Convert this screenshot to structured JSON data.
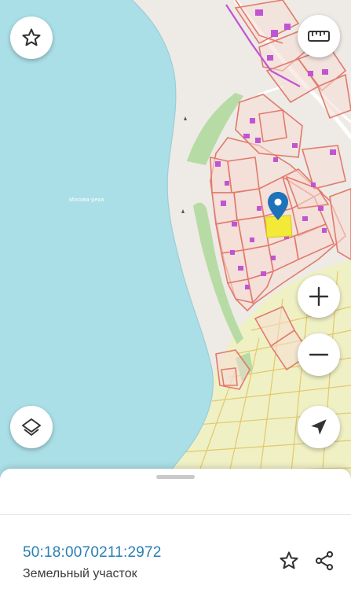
{
  "map": {
    "water_label": "Москва-река",
    "colors": {
      "water": "#abdfe7",
      "land": "#eeeae6",
      "forest": "#b7dba4",
      "parcel_border": "#e27a6c",
      "parcel_fill": "#f6dcd6",
      "building": "#c154d2",
      "road": "#ffffff",
      "zone": "#f0f0c5",
      "zone_lines": "#e2c86a",
      "selected_parcel": "#f2ea37",
      "marker": "#1e72b8"
    }
  },
  "controls": {
    "favorite": {
      "icon": "star-icon"
    },
    "ruler": {
      "icon": "ruler-icon"
    },
    "zoom_in": {
      "icon": "plus-icon"
    },
    "zoom_out": {
      "icon": "minus-icon"
    },
    "layers": {
      "icon": "layers-icon"
    },
    "locate": {
      "icon": "navigation-arrow-icon"
    }
  },
  "sheet": {
    "cadastral_number": "50:18:0070211:2972",
    "object_type": "Земельный участок",
    "actions": [
      {
        "icon": "star-outline-icon"
      },
      {
        "icon": "share-icon"
      }
    ]
  }
}
